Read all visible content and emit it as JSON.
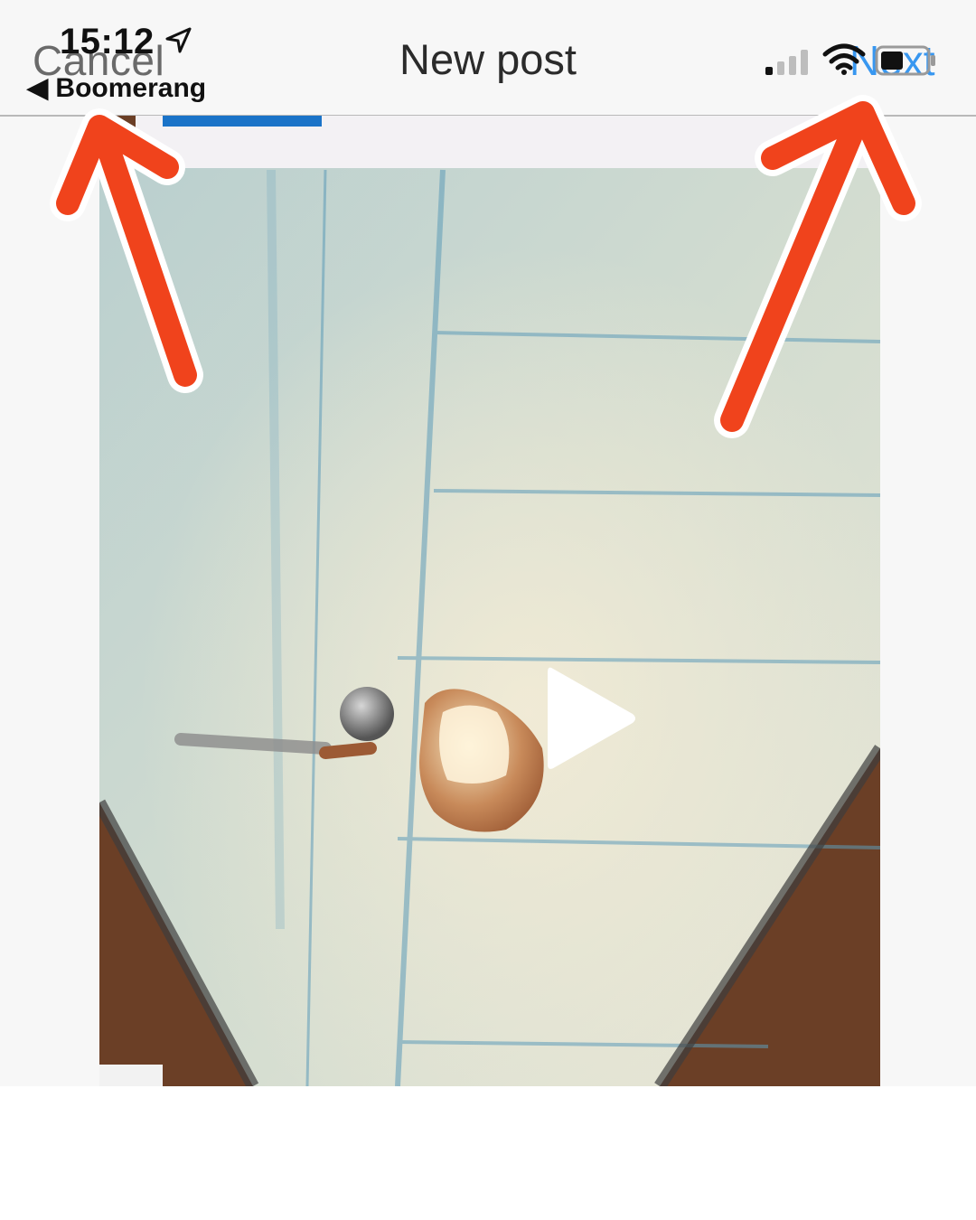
{
  "status_bar": {
    "time": "15:12",
    "back_app_label": "◀ Boomerang"
  },
  "nav": {
    "cancel_label": "Cancel",
    "title": "New post",
    "next_label": "Next"
  },
  "media": {
    "type": "video",
    "play_icon": "play-icon"
  },
  "annotations": {
    "arrow_color": "#f0431c",
    "arrows": [
      "arrow-to-cancel",
      "arrow-to-next"
    ]
  },
  "colors": {
    "next_link": "#3897f0",
    "header_bg": "#f7f7f7"
  }
}
